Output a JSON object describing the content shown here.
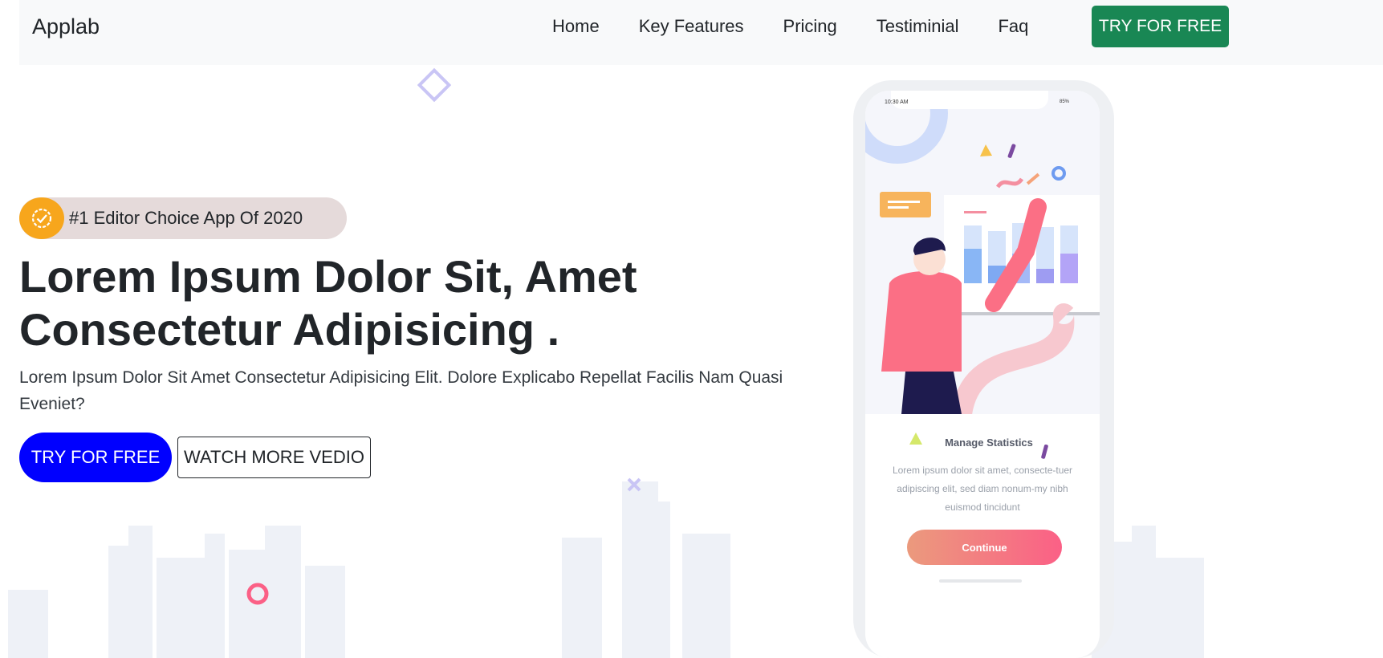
{
  "navbar": {
    "brand": "Applab",
    "links": [
      "Home",
      "Key Features",
      "Pricing",
      "Testiminial",
      "Faq"
    ],
    "cta_label": "TRY FOR FREE"
  },
  "hero": {
    "badge_text": "#1 Editor Choice App Of 2020",
    "title": "Lorem Ipsum Dolor Sit, Amet Consectetur Adipisicing .",
    "subtitle": "Lorem Ipsum Dolor Sit Amet Consectetur Adipisicing Elit. Dolore Explicabo Repellat Facilis Nam Quasi Eveniet?",
    "primary_button": "TRY FOR FREE",
    "secondary_button": "WATCH MORE VEDIO"
  },
  "phone": {
    "status_time": "10:30 AM",
    "status_battery": "85%",
    "card_title": "Manage Statistics",
    "card_text": "Lorem ipsum dolor sit amet, consecte-tuer adipiscing elit, sed diam nonum-my nibh euismod tincidunt",
    "button_label": "Continue"
  },
  "colors": {
    "nav_cta": "#198754",
    "primary_button": "#0000ff",
    "badge_icon": "#f7a61c",
    "continue_gradient_start": "#eb9a7d",
    "continue_gradient_end": "#fb6086"
  },
  "icons": {
    "badge": "verified-check-icon",
    "decoration": "diamond-outline-icon"
  }
}
